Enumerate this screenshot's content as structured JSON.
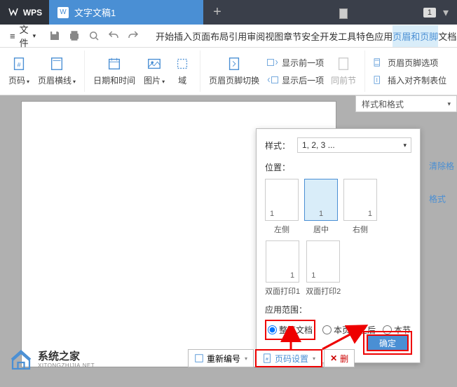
{
  "titlebar": {
    "app": "WPS",
    "tab": "文字文稿1",
    "badge": "1"
  },
  "menubar": {
    "file": "文件",
    "tabs": [
      "开始",
      "插入",
      "页面布局",
      "引用",
      "审阅",
      "视图",
      "章节",
      "安全",
      "开发工具",
      "特色应用",
      "页眉和页脚",
      "文档助手"
    ],
    "active_index": 10
  },
  "ribbon": {
    "page_number": "页码",
    "page_line": "页眉横线",
    "datetime": "日期和时间",
    "picture": "图片",
    "field": "域",
    "switch": "页眉页脚切换",
    "show_prev": "显示前一项",
    "show_next": "显示后一项",
    "same_section": "同前节",
    "options": "页眉页脚选项",
    "insert_align": "插入对齐制表位"
  },
  "styles_panel": {
    "title": "样式和格式",
    "clear": "清除格",
    "format": "格式"
  },
  "popover": {
    "style_label": "样式：",
    "style_value": "1, 2, 3 ...",
    "position_label": "位置：",
    "sample": "1",
    "pos_left": "左侧",
    "pos_center": "居中",
    "pos_right": "右侧",
    "duplex1": "双面打印1",
    "duplex2": "双面打印2",
    "scope_label": "应用范围：",
    "scope_all": "整篇文档",
    "scope_from": "本页及之后",
    "scope_section": "本节",
    "ok": "确定"
  },
  "bottombar": {
    "renumber": "重新编号",
    "page_setup": "页码设置",
    "delete": "删"
  },
  "watermark": {
    "cn": "系统之家",
    "en": "XITONGZHIJIA.NET"
  }
}
